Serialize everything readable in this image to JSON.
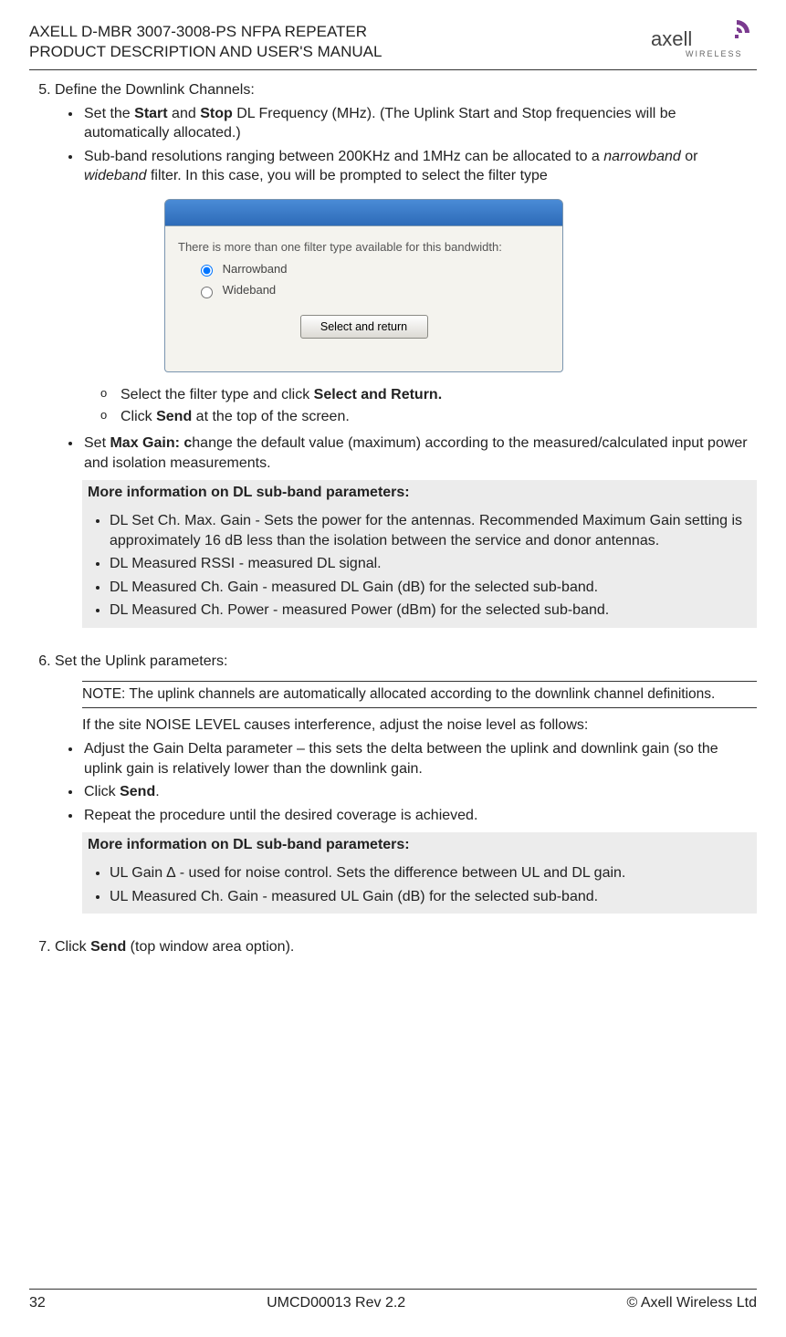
{
  "header": {
    "l1": "AXELL D-MBR 3007-3008-PS NFPA REPEATER",
    "l2": "PRODUCT DESCRIPTION AND USER'S MANUAL",
    "brand": "axell",
    "brand2": "WIRELESS"
  },
  "step5": {
    "title": "Define the Downlink Channels:",
    "b1": "Set the <b>Start</b> and <b>Stop</b> DL Frequency (MHz). (The Uplink Start and Stop frequencies will be automatically allocated.)",
    "b2": "Sub-band resolutions ranging between 200KHz and 1MHz can be allocated to a <i>narrowband</i> or <i>wideband</i> filter. In this case, you will be prompted to select the filter type",
    "dlg": {
      "msg": "There is more than one filter type available for this bandwidth:",
      "opt1": "Narrowband",
      "opt2": "Wideband",
      "btn": "Select and return"
    },
    "s1": "Select the filter type and click <b>Select and Return.</b>",
    "s2": "Click <b>Send</b> at the top of the screen.",
    "b3": "Set <b>Max Gain: c</b>hange the default value (maximum) according to the measured/calculated input power and isolation measurements.",
    "infohdr": "More information on DL sub-band parameters:",
    "i1": "DL Set Ch. Max. Gain - Sets the power for the antennas. Recommended Maximum Gain setting is approximately 16 dB less than the isolation between the service and donor antennas.",
    "i2": "DL Measured RSSI - measured DL signal.",
    "i3": "DL Measured Ch. Gain - measured DL Gain (dB) for the selected sub-band.",
    "i4": "DL Measured Ch. Power - measured Power (dBm) for the selected sub-band."
  },
  "step6": {
    "title": "Set the Uplink parameters:",
    "note": "NOTE: The uplink channels are automatically allocated according to the downlink channel definitions.",
    "para": "If the site NOISE LEVEL causes interference, adjust the noise level as follows:",
    "b1": "Adjust the Gain Delta parameter – this sets the delta between the uplink and downlink gain (so the uplink gain is relatively lower than the downlink gain.",
    "b2": "Click <b>Send</b>.",
    "b3": "Repeat the procedure until the desired coverage is achieved.",
    "infohdr": "More information on DL sub-band parameters:",
    "i1": "UL Gain ∆ - used for noise control. Sets the difference between UL and DL gain.",
    "i2": "UL Measured Ch. Gain - measured UL Gain (dB) for the selected sub-band."
  },
  "step7": {
    "text": "Click <b>Send</b> (top window area option)."
  },
  "footer": {
    "left": "32",
    "mid": "UMCD00013 Rev 2.2",
    "right": "© Axell Wireless Ltd"
  }
}
